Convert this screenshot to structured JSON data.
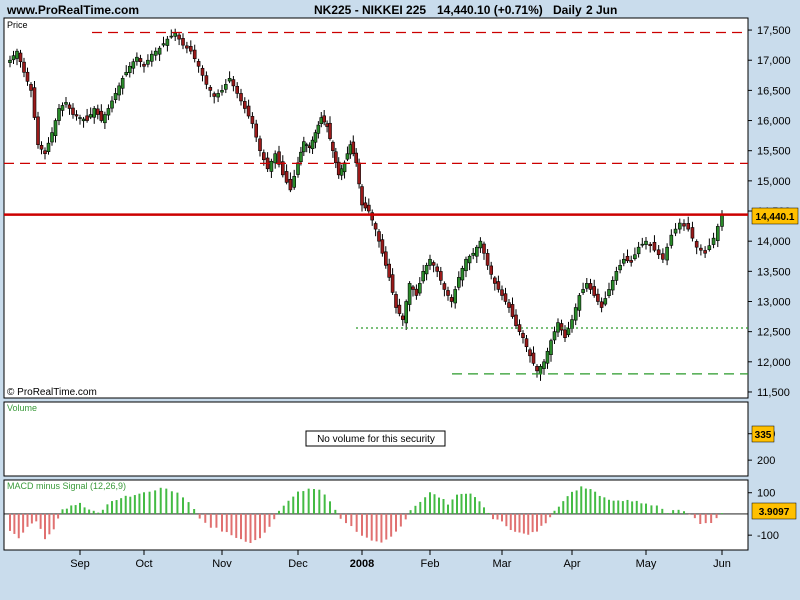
{
  "header": {
    "site": "www.ProRealTime.com",
    "instrument": "NK225 - NIKKEI 225",
    "quote": "14,440.10 (+0.71%)",
    "period": "Daily",
    "date": "2 Jun"
  },
  "price_panel": {
    "label": "Price",
    "copyright": "© ProRealTime.com",
    "last_value_label": "14,440.1"
  },
  "volume_panel": {
    "label": "Volume",
    "message": "No volume for this security",
    "marker_label": "335"
  },
  "macd_panel": {
    "label": "MACD minus Signal (12,26,9)",
    "last_value_label": "3.9097"
  },
  "colors": {
    "background": "#c9dcec",
    "up_candle": "#3a9a3a",
    "down_candle": "#b02020",
    "level_line": "#cc0000",
    "support_line": "#2a9a2a",
    "macd_positive": "#44bb44",
    "macd_negative": "#e07070",
    "label_badge": "#ffc000"
  },
  "chart_data": [
    {
      "type": "candlestick",
      "title": "NK225 - NIKKEI 225",
      "xlabel": "",
      "ylabel": "Price",
      "x_tick_labels": [
        "Sep",
        "Oct",
        "Nov",
        "Dec",
        "2008",
        "Feb",
        "Mar",
        "Apr",
        "May",
        "Jun"
      ],
      "y_ticks": [
        11500,
        12000,
        12500,
        13000,
        13500,
        14000,
        14500,
        15000,
        15500,
        16000,
        16500,
        17000,
        17500
      ],
      "y_tick_labels": [
        "11,500",
        "12,000",
        "12,500",
        "13,000",
        "13,500",
        "14,000",
        "14,500",
        "15,000",
        "15,500",
        "16,000",
        "16,500",
        "17,000",
        "17,500"
      ],
      "ylim": [
        11400,
        17700
      ],
      "last_close": 14440.1,
      "horizontal_levels": [
        {
          "value": 17460,
          "style": "dashed",
          "color": "#cc0000"
        },
        {
          "value": 15290,
          "style": "dashed",
          "color": "#cc0000"
        },
        {
          "value": 14440.1,
          "style": "solid",
          "color": "#cc0000"
        },
        {
          "value": 12560,
          "style": "dotted",
          "color": "#2a9a2a",
          "from_month": "2008"
        },
        {
          "value": 11800,
          "style": "dashed",
          "color": "#2a9a2a",
          "from_month": "Feb"
        }
      ],
      "close_path": [
        {
          "x": "Aug",
          "y": 17000
        },
        {
          "y": 17150
        },
        {
          "y": 16800
        },
        {
          "y": 16500
        },
        {
          "y": 15600
        },
        {
          "y": 15450
        },
        {
          "y": 15800
        },
        {
          "y": 16200
        },
        {
          "y": 16300
        },
        {
          "y": 16100
        },
        {
          "x": "Sep",
          "y": 16050
        },
        {
          "y": 16000
        },
        {
          "y": 16200
        },
        {
          "y": 16000
        },
        {
          "y": 16200
        },
        {
          "y": 16450
        },
        {
          "y": 16700
        },
        {
          "y": 16900
        },
        {
          "y": 17050
        },
        {
          "x": "Oct",
          "y": 16900
        },
        {
          "y": 17100
        },
        {
          "y": 17200
        },
        {
          "y": 17350
        },
        {
          "y": 17450
        },
        {
          "y": 17250
        },
        {
          "y": 17150
        },
        {
          "y": 16900
        },
        {
          "y": 16600
        },
        {
          "y": 16400
        },
        {
          "x": "Nov",
          "y": 16500
        },
        {
          "y": 16700
        },
        {
          "y": 16450
        },
        {
          "y": 16200
        },
        {
          "y": 15950
        },
        {
          "y": 15500
        },
        {
          "y": 15200
        },
        {
          "y": 15450
        },
        {
          "y": 15100
        },
        {
          "y": 14850
        },
        {
          "x": "Dec",
          "y": 15300
        },
        {
          "y": 15650
        },
        {
          "y": 15550
        },
        {
          "y": 15800
        },
        {
          "y": 16050
        },
        {
          "y": 15900
        },
        {
          "y": 15500
        },
        {
          "y": 15100
        },
        {
          "y": 15300
        },
        {
          "y": 15600
        },
        {
          "y": 15300
        },
        {
          "x": "2008",
          "y": 14600
        },
        {
          "y": 14500
        },
        {
          "y": 14200
        },
        {
          "y": 13800
        },
        {
          "y": 13400
        },
        {
          "y": 12900
        },
        {
          "y": 12700
        },
        {
          "y": 13300
        },
        {
          "y": 13100
        },
        {
          "y": 13500
        },
        {
          "x": "Feb",
          "y": 13700
        },
        {
          "y": 13500
        },
        {
          "y": 13200
        },
        {
          "y": 13000
        },
        {
          "y": 13400
        },
        {
          "y": 13700
        },
        {
          "y": 13800
        },
        {
          "y": 14000
        },
        {
          "y": 13600
        },
        {
          "y": 13300
        },
        {
          "x": "Mar",
          "y": 13100
        },
        {
          "y": 12900
        },
        {
          "y": 12600
        },
        {
          "y": 12400
        },
        {
          "y": 12100
        },
        {
          "y": 11850
        },
        {
          "y": 12000
        },
        {
          "y": 12350
        },
        {
          "y": 12650
        },
        {
          "y": 12400
        },
        {
          "x": "Apr",
          "y": 12700
        },
        {
          "y": 13100
        },
        {
          "y": 13300
        },
        {
          "y": 13100
        },
        {
          "y": 12900
        },
        {
          "y": 13200
        },
        {
          "y": 13500
        },
        {
          "y": 13700
        },
        {
          "y": 13650
        },
        {
          "y": 13900
        },
        {
          "x": "May",
          "y": 14000
        },
        {
          "y": 13850
        },
        {
          "y": 13700
        },
        {
          "y": 14100
        },
        {
          "y": 14300
        },
        {
          "y": 14200
        },
        {
          "y": 13900
        },
        {
          "y": 13800
        },
        {
          "y": 14050
        },
        {
          "x": "Jun",
          "y": 14440.1
        }
      ]
    },
    {
      "type": "bar",
      "title": "Volume",
      "y_ticks": [
        200,
        300
      ],
      "y_tick_labels": [
        "200",
        "300"
      ],
      "ylim": [
        140,
        420
      ],
      "series": []
    },
    {
      "type": "bar",
      "title": "MACD minus Signal (12,26,9)",
      "y_ticks": [
        100,
        -100
      ],
      "y_tick_labels": [
        "100",
        "-100"
      ],
      "ylim": [
        -170,
        160
      ],
      "last_value": 3.9097,
      "values_path": [
        {
          "x": "Aug",
          "y": -80
        },
        {
          "y": -110
        },
        {
          "y": -60
        },
        {
          "y": -30
        },
        {
          "y": -120
        },
        {
          "y": -70
        },
        {
          "y": 20
        },
        {
          "y": 40
        },
        {
          "x": "Sep",
          "y": 50
        },
        {
          "y": 20
        },
        {
          "y": 10
        },
        {
          "y": 40
        },
        {
          "y": 70
        },
        {
          "y": 80
        },
        {
          "y": 90
        },
        {
          "x": "Oct",
          "y": 100
        },
        {
          "y": 115
        },
        {
          "y": 120
        },
        {
          "y": 100
        },
        {
          "y": 60
        },
        {
          "y": -20
        },
        {
          "y": -60
        },
        {
          "x": "Nov",
          "y": -80
        },
        {
          "y": -100
        },
        {
          "y": -120
        },
        {
          "y": -140
        },
        {
          "y": -110
        },
        {
          "y": -60
        },
        {
          "y": 20
        },
        {
          "y": 60
        },
        {
          "x": "Dec",
          "y": 100
        },
        {
          "y": 120
        },
        {
          "y": 115
        },
        {
          "y": 60
        },
        {
          "y": -20
        },
        {
          "y": -60
        },
        {
          "x": "2008",
          "y": -100
        },
        {
          "y": -130
        },
        {
          "y": -140
        },
        {
          "y": -110
        },
        {
          "y": -60
        },
        {
          "y": 20
        },
        {
          "y": 60
        },
        {
          "x": "Feb",
          "y": 100
        },
        {
          "y": 80
        },
        {
          "y": 50
        },
        {
          "y": 90
        },
        {
          "y": 100
        },
        {
          "y": 80
        },
        {
          "y": 30
        },
        {
          "y": -20
        },
        {
          "x": "Mar",
          "y": -40
        },
        {
          "y": -70
        },
        {
          "y": -90
        },
        {
          "y": -100
        },
        {
          "y": -80
        },
        {
          "y": -40
        },
        {
          "y": 20
        },
        {
          "y": 60
        },
        {
          "x": "Apr",
          "y": 100
        },
        {
          "y": 130
        },
        {
          "y": 120
        },
        {
          "y": 90
        },
        {
          "y": 70
        },
        {
          "y": 60
        },
        {
          "y": 70
        },
        {
          "y": 60
        },
        {
          "x": "May",
          "y": 50
        },
        {
          "y": 40
        },
        {
          "y": 10
        },
        {
          "y": 20
        },
        {
          "y": 0
        },
        {
          "y": -50
        },
        {
          "y": -40
        },
        {
          "x": "Jun",
          "y": 3.9
        }
      ]
    }
  ]
}
